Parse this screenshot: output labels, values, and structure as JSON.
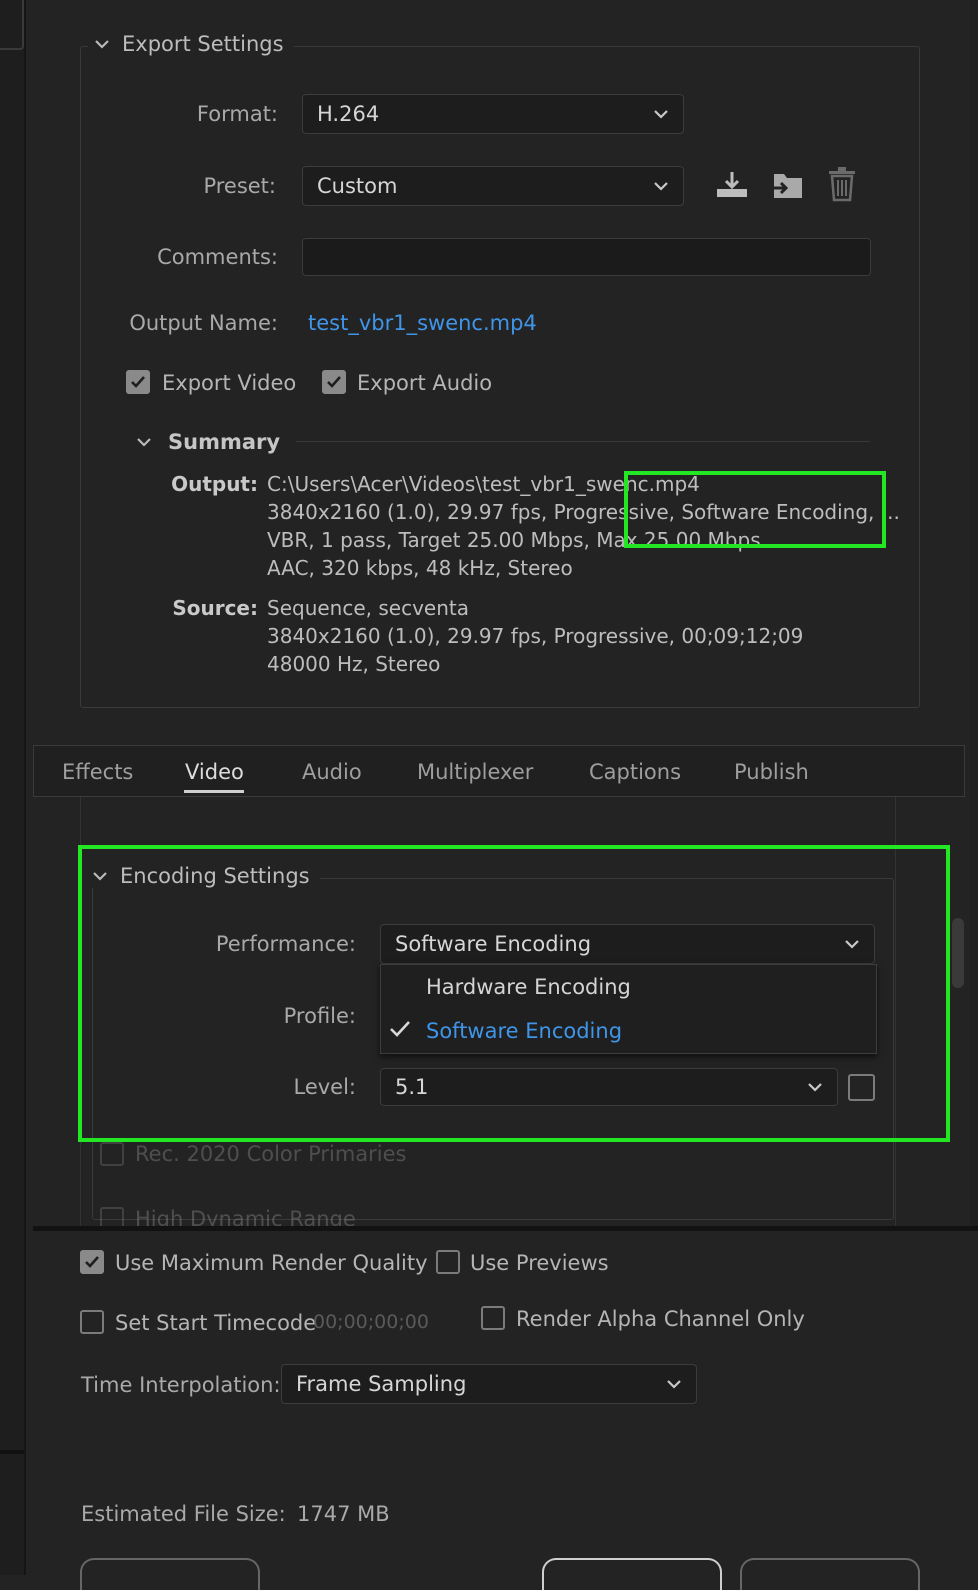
{
  "export_settings": {
    "section_title": "Export Settings",
    "format_label": "Format:",
    "format_value": "H.264",
    "preset_label": "Preset:",
    "preset_value": "Custom",
    "comments_label": "Comments:",
    "comments_value": "",
    "output_name_label": "Output Name:",
    "output_name_value": "test_vbr1_swenc.mp4",
    "export_video_label": "Export Video",
    "export_audio_label": "Export Audio",
    "preset_icons": [
      "save-preset-icon",
      "import-preset-icon",
      "delete-preset-icon"
    ]
  },
  "summary": {
    "title": "Summary",
    "output_label": "Output:",
    "output_lines": [
      "C:\\Users\\Acer\\Videos\\test_vbr1_swenc.mp4",
      "3840x2160 (1.0), 29.97 fps, Progressive, Software Encoding, ...",
      "VBR, 1 pass, Target 25.00 Mbps, Max 25.00 Mbps",
      "AAC, 320 kbps, 48 kHz, Stereo"
    ],
    "source_label": "Source:",
    "source_lines": [
      "Sequence, secventa",
      "3840x2160 (1.0), 29.97 fps, Progressive, 00;09;12;09",
      "48000 Hz, Stereo"
    ]
  },
  "tabs": [
    "Effects",
    "Video",
    "Audio",
    "Multiplexer",
    "Captions",
    "Publish"
  ],
  "active_tab": "Video",
  "encoding_settings": {
    "section_title": "Encoding Settings",
    "performance_label": "Performance:",
    "performance_value": "Software Encoding",
    "performance_options": [
      "Hardware Encoding",
      "Software Encoding"
    ],
    "selected_option": "Software Encoding",
    "profile_label": "Profile:",
    "level_label": "Level:",
    "level_value": "5.1",
    "rec2020_label": "Rec. 2020 Color Primaries",
    "hdr_label": "High Dynamic Range"
  },
  "bottom": {
    "max_render_quality_label": "Use Maximum Render Quality",
    "use_previews_label": "Use Previews",
    "set_start_timecode_label": "Set Start Timecode",
    "start_timecode_value": "00;00;00;00",
    "render_alpha_label": "Render Alpha Channel Only",
    "time_interpolation_label": "Time Interpolation:",
    "time_interpolation_value": "Frame Sampling",
    "estimated_size_label": "Estimated File Size:",
    "estimated_size_value": "1747 MB"
  },
  "colors": {
    "highlight": "#22e722",
    "link": "#3f95e8",
    "background": "#232323"
  }
}
